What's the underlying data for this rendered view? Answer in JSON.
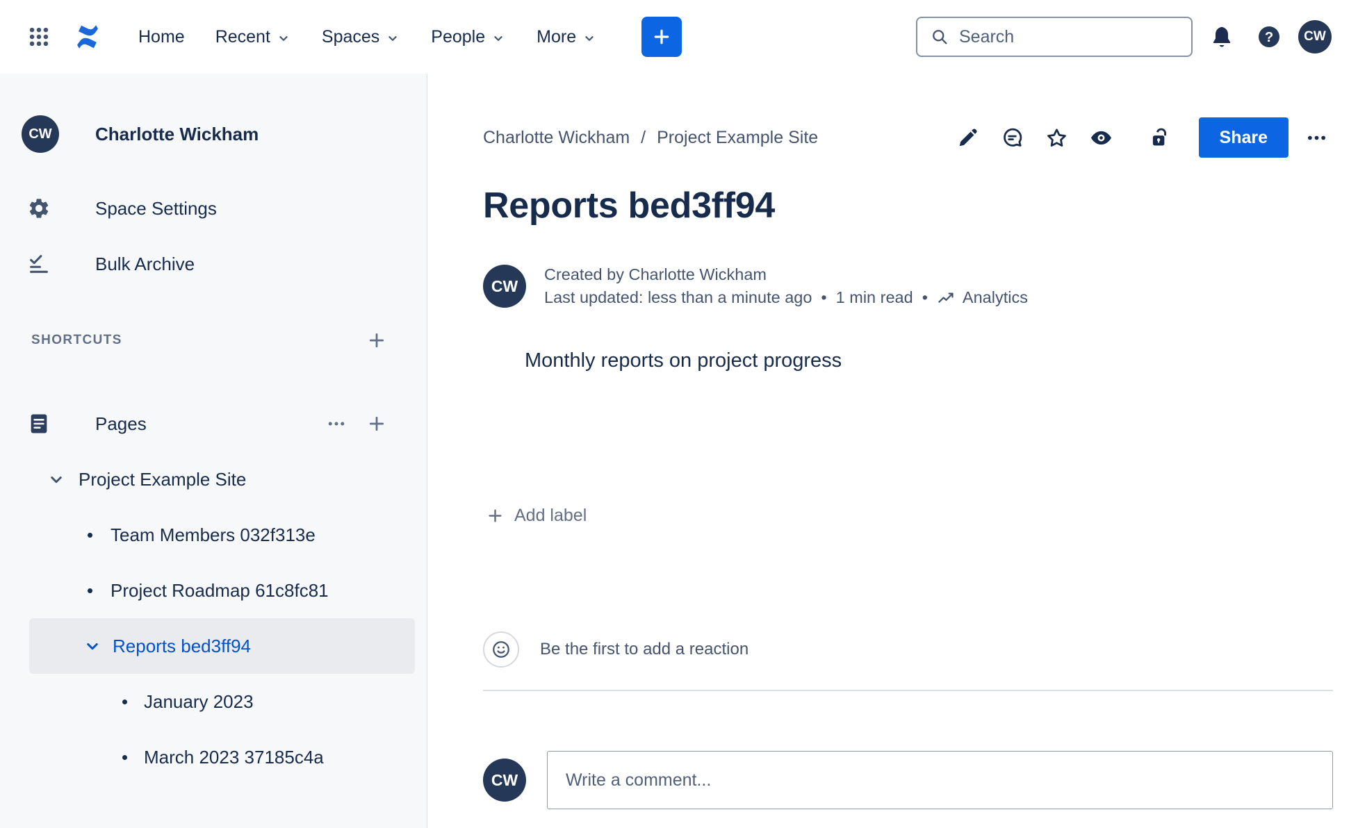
{
  "topbar": {
    "nav": [
      {
        "label": "Home",
        "has_dropdown": false
      },
      {
        "label": "Recent",
        "has_dropdown": true
      },
      {
        "label": "Spaces",
        "has_dropdown": true
      },
      {
        "label": "People",
        "has_dropdown": true
      },
      {
        "label": "More",
        "has_dropdown": true
      }
    ],
    "search_placeholder": "Search",
    "help_glyph": "?",
    "avatar_initials": "CW"
  },
  "sidebar": {
    "avatar_initials": "CW",
    "space_name": "Charlotte Wickham",
    "menu": [
      {
        "label": "Space Settings",
        "icon": "gear-icon"
      },
      {
        "label": "Bulk Archive",
        "icon": "bulk-archive-icon"
      }
    ],
    "shortcuts_label": "SHORTCUTS",
    "pages_label": "Pages",
    "tree": {
      "root_label": "Project Example Site",
      "items": [
        {
          "label": "Team Members 032f313e"
        },
        {
          "label": "Project Roadmap 61c8fc81"
        },
        {
          "label": "Reports bed3ff94",
          "selected": true
        }
      ],
      "subitems": [
        {
          "label": "January 2023"
        },
        {
          "label": "March 2023 37185c4a"
        }
      ]
    }
  },
  "main": {
    "breadcrumb": {
      "items": [
        "Charlotte Wickham",
        "Project Example Site"
      ],
      "separator": "/"
    },
    "share_label": "Share",
    "title": "Reports bed3ff94",
    "byline": {
      "avatar_initials": "CW",
      "created_line": "Created by Charlotte Wickham",
      "updated_text": "Last updated: less than a minute ago",
      "separator": "•",
      "read_time": "1 min read",
      "analytics_label": "Analytics"
    },
    "body_text": "Monthly reports on project progress",
    "add_label_text": "Add label",
    "reaction_prompt": "Be the first to add a reaction",
    "comment_placeholder": "Write a comment...",
    "comment_avatar_initials": "CW"
  },
  "colors": {
    "brand_blue": "#0C66E4",
    "logo_blue": "#1868DB",
    "selected_blue": "#0052CC",
    "text_navy": "#172B4D",
    "muted_gray": "#44546F",
    "sidebar_bg": "#F7F8F9",
    "selected_bg": "#E9EBEE",
    "avatar_bg": "#253858"
  }
}
